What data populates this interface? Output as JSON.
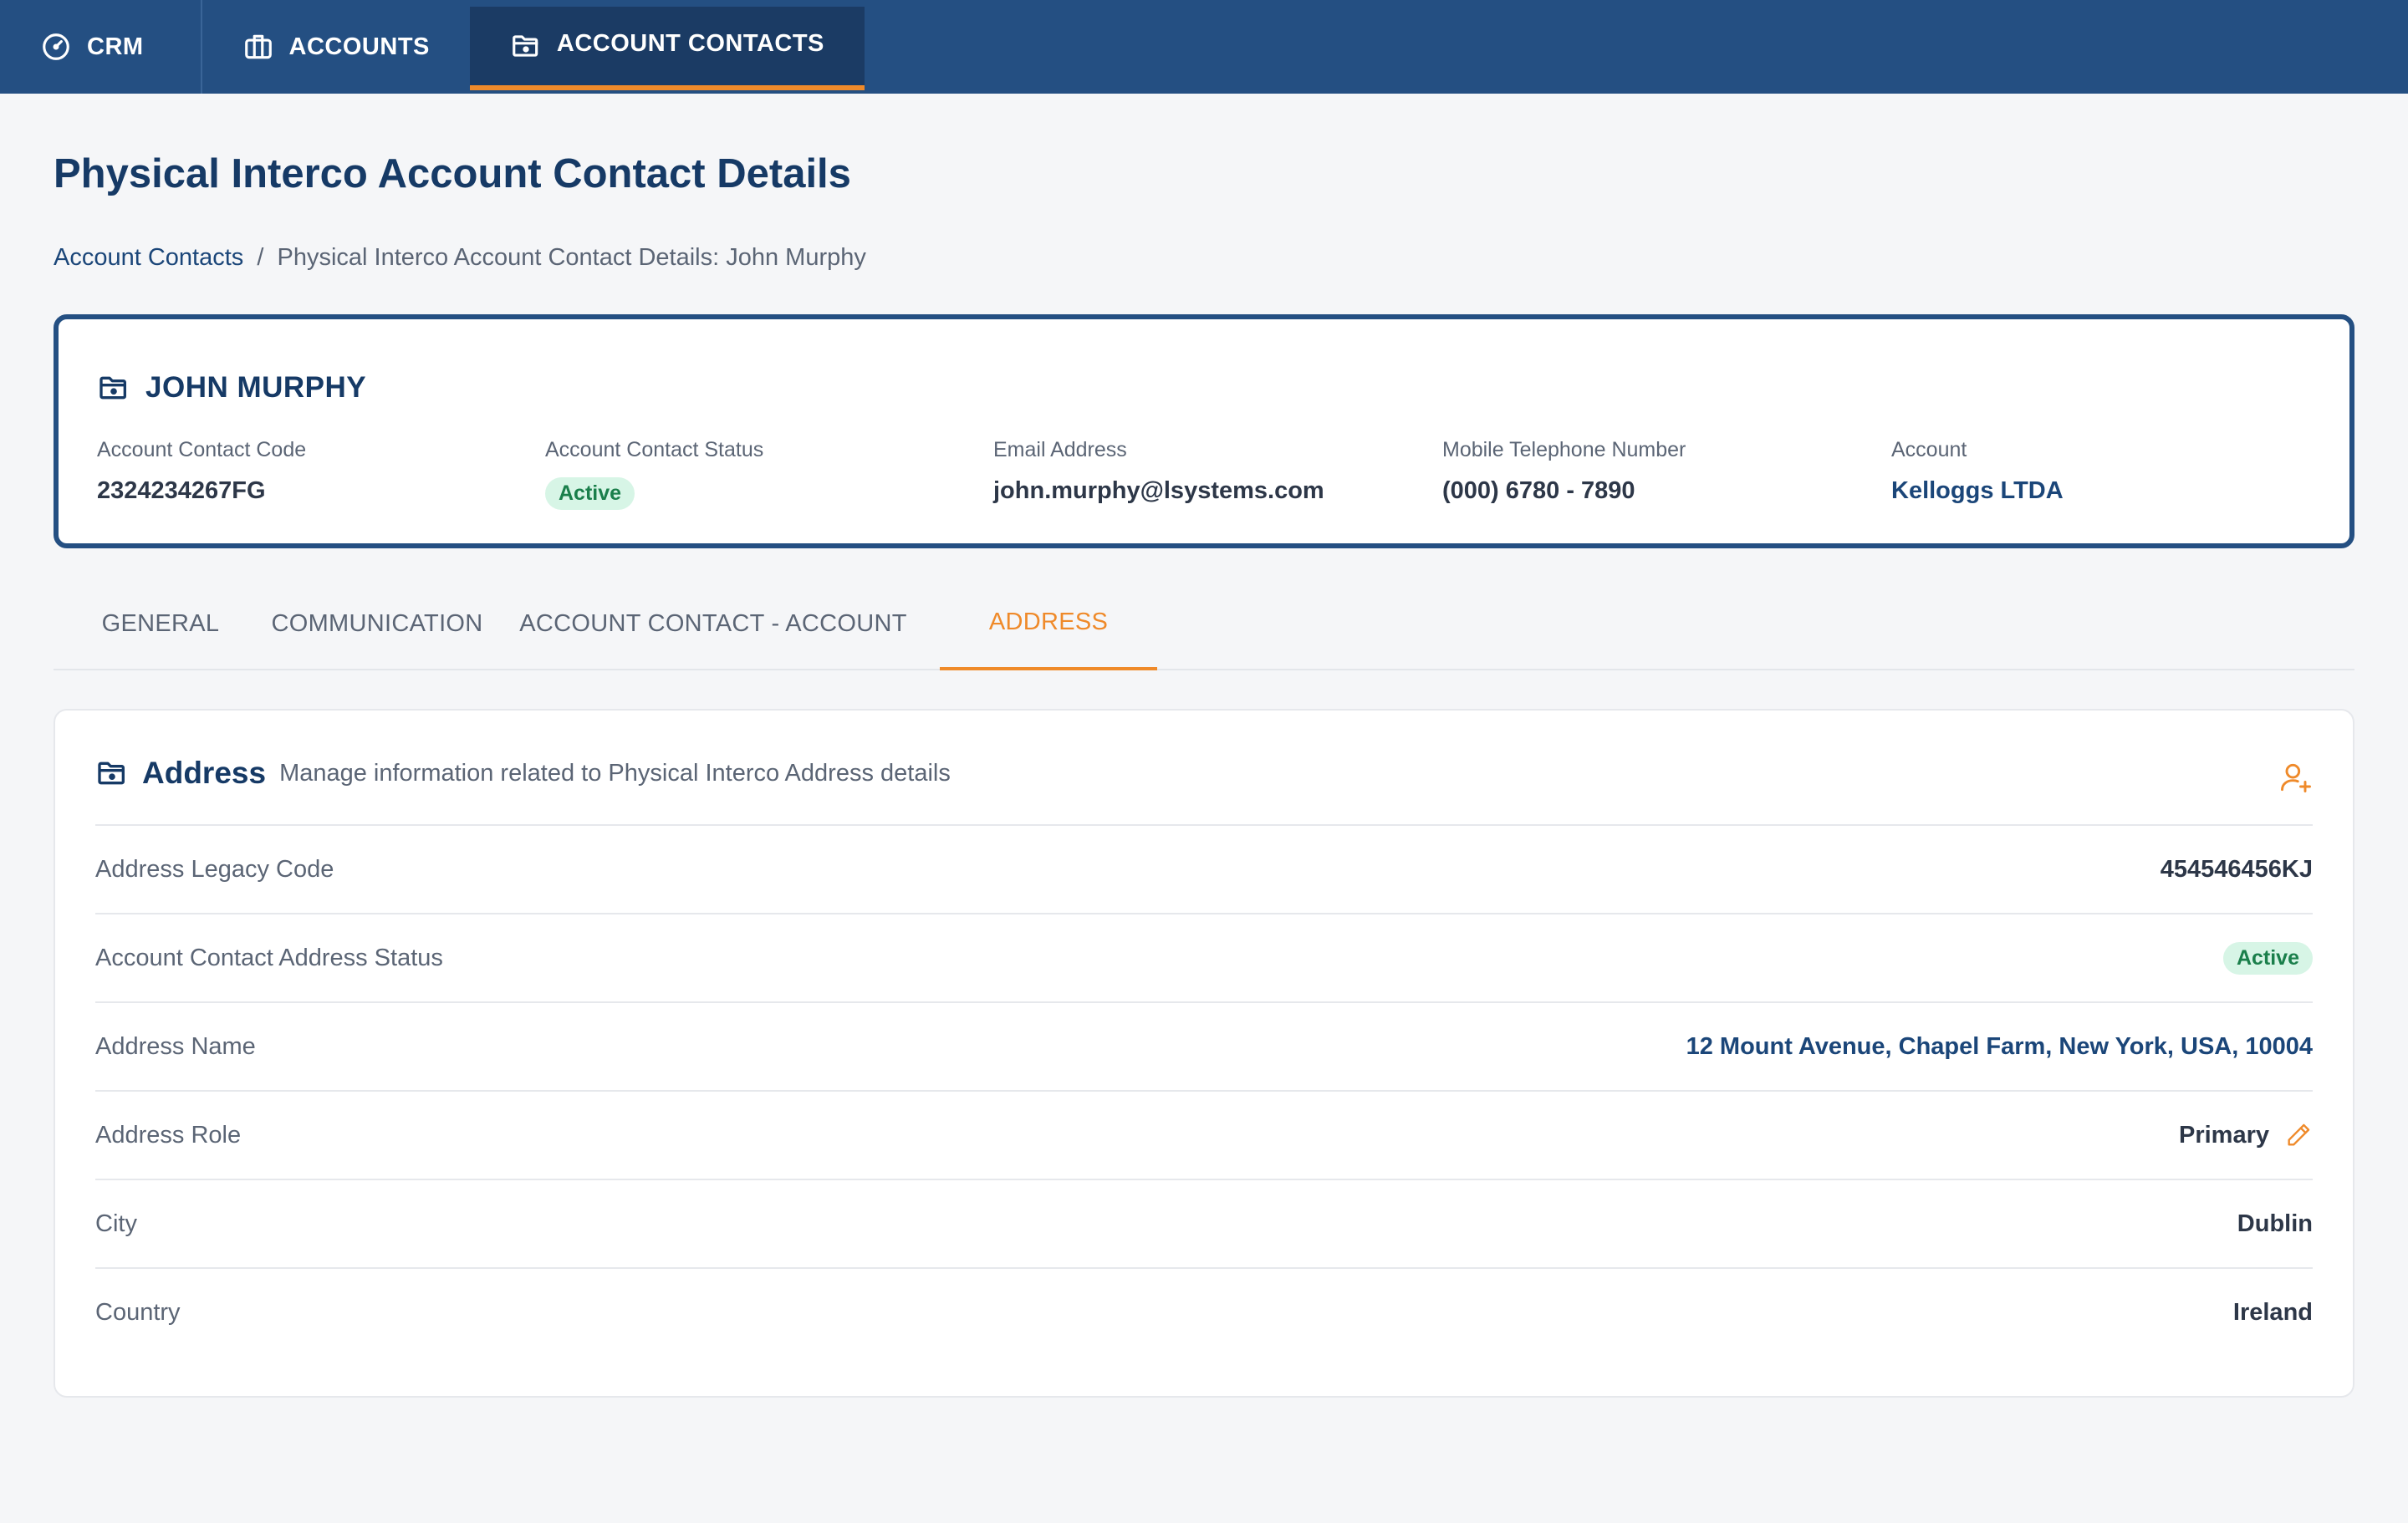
{
  "nav": {
    "tabs": [
      {
        "label": "CRM",
        "icon": "gauge-icon"
      },
      {
        "label": "ACCOUNTS",
        "icon": "briefcase-icon"
      },
      {
        "label": "ACCOUNT CONTACTS",
        "icon": "folder-icon",
        "active": true
      }
    ]
  },
  "page": {
    "title": "Physical Interco Account Contact Details",
    "breadcrumb": {
      "parent": "Account Contacts",
      "separator": "/",
      "current": "Physical Interco Account Contact Details: John Murphy"
    }
  },
  "summary": {
    "name": "JOHN MURPHY",
    "fields": [
      {
        "label": "Account Contact Code",
        "value": "2324234267FG"
      },
      {
        "label": "Account Contact Status",
        "value": "Active"
      },
      {
        "label": "Email Address",
        "value": "john.murphy@lsystems.com"
      },
      {
        "label": "Mobile Telephone Number",
        "value": "(000) 6780 - 7890"
      },
      {
        "label": "Account",
        "value": "Kelloggs LTDA"
      }
    ]
  },
  "tabs": [
    {
      "label": "GENERAL"
    },
    {
      "label": "COMMUNICATION"
    },
    {
      "label": "ACCOUNT CONTACT - ACCOUNT"
    },
    {
      "label": "ADDRESS",
      "active": true
    }
  ],
  "address": {
    "title": "Address",
    "subtitle": "Manage information related to Physical Interco Address details",
    "rows": [
      {
        "label": "Address Legacy Code",
        "value": "454546456KJ"
      },
      {
        "label": "Account Contact Address Status",
        "value": "Active"
      },
      {
        "label": "Address Name",
        "value": "12 Mount Avenue, Chapel Farm, New York, USA, 10004"
      },
      {
        "label": "Address Role",
        "value": "Primary"
      },
      {
        "label": "City",
        "value": "Dublin"
      },
      {
        "label": "Country",
        "value": "Ireland"
      }
    ]
  },
  "colors": {
    "nav_bg": "#244f82",
    "nav_active_bg": "#1b3b64",
    "accent": "#ef8a2a",
    "title": "#163a66",
    "link": "#1b4679",
    "badge_bg": "#d7f5e6",
    "badge_text": "#1a7f4b"
  }
}
